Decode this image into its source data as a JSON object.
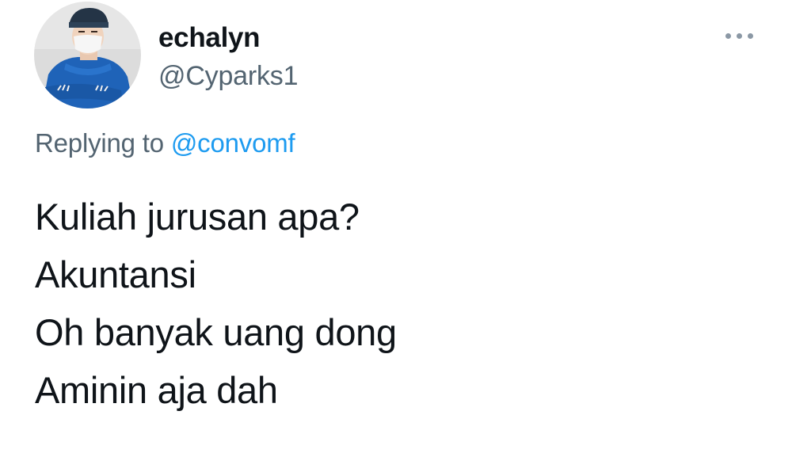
{
  "user": {
    "display_name": "echalyn",
    "handle": "@Cyparks1"
  },
  "header": {
    "more_icon": "more-horizontal-icon"
  },
  "reply": {
    "prefix": "Replying to",
    "mention": "@convomf"
  },
  "tweet": {
    "lines": [
      "Kuliah jurusan apa?",
      "Akuntansi",
      "Oh banyak uang dong",
      "Aminin aja dah"
    ]
  },
  "colors": {
    "text": "#0f1419",
    "secondary": "#536471",
    "link": "#1d9bf0",
    "icon": "#8b98a5",
    "background": "#ffffff"
  }
}
